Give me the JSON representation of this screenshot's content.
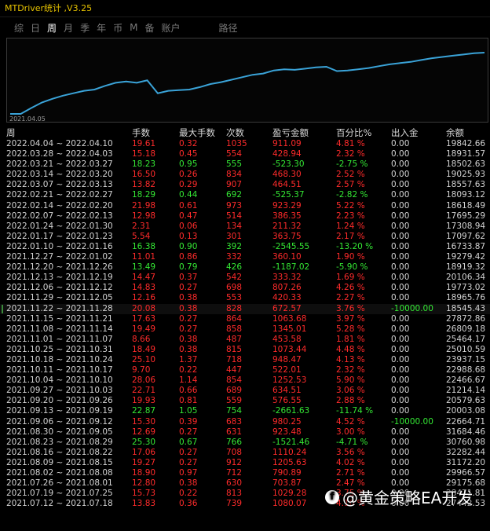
{
  "window": {
    "title": "MTDriver统计 ,V3.25"
  },
  "tabs": [
    {
      "label": "综",
      "active": false
    },
    {
      "label": "日",
      "active": false
    },
    {
      "label": "周",
      "active": true
    },
    {
      "label": "月",
      "active": false
    },
    {
      "label": "季",
      "active": false
    },
    {
      "label": "年",
      "active": false
    },
    {
      "label": "币",
      "active": false
    },
    {
      "label": "M",
      "active": false
    },
    {
      "label": "备",
      "active": false
    },
    {
      "label": "账户",
      "active": false
    }
  ],
  "path_tab": "路径",
  "chart_data": {
    "type": "line",
    "series": [
      {
        "values": [
          19842.66,
          19842.66,
          20800,
          21700,
          22300,
          22800,
          23200,
          23600,
          23800,
          24400,
          24900,
          25100,
          24900,
          25300,
          23200,
          23600,
          23700,
          23800,
          24200,
          24700,
          25000,
          25400,
          25800,
          26200,
          26400,
          26900,
          27100,
          27000,
          27200,
          27400,
          27500,
          26800,
          26900,
          27100,
          27300,
          27600,
          27900,
          28100,
          28300,
          28600,
          28900,
          29100,
          29300,
          29500,
          29700,
          29800
        ]
      }
    ],
    "color": "#3aa3d8",
    "x_start_label": "2021.04.05"
  },
  "table": {
    "headers": [
      "周",
      "手数",
      "最大手数",
      "次数",
      "盈亏金额",
      "百分比%",
      "出入金",
      "余额"
    ],
    "rows": [
      {
        "week": "2022.04.04 ~ 2022.04.10",
        "lots": "19.61",
        "max": "0.32",
        "count": "1035",
        "pnl": "911.09",
        "pct": "4.81 %",
        "flow": "0.00",
        "balance": "19842.66",
        "tone": "red"
      },
      {
        "week": "2022.03.28 ~ 2022.04.03",
        "lots": "15.18",
        "max": "0.45",
        "count": "554",
        "pnl": "428.94",
        "pct": "2.32 %",
        "flow": "0.00",
        "balance": "18931.57",
        "tone": "red"
      },
      {
        "week": "2022.03.21 ~ 2022.03.27",
        "lots": "18.23",
        "max": "0.95",
        "count": "555",
        "pnl": "-523.30",
        "pct": "-2.75 %",
        "flow": "0.00",
        "balance": "18502.63",
        "tone": "pos"
      },
      {
        "week": "2022.03.14 ~ 2022.03.20",
        "lots": "16.50",
        "max": "0.26",
        "count": "834",
        "pnl": "468.30",
        "pct": "2.52 %",
        "flow": "0.00",
        "balance": "19025.93",
        "tone": "red"
      },
      {
        "week": "2022.03.07 ~ 2022.03.13",
        "lots": "13.82",
        "max": "0.29",
        "count": "907",
        "pnl": "464.51",
        "pct": "2.57 %",
        "flow": "0.00",
        "balance": "18557.63",
        "tone": "red"
      },
      {
        "week": "2022.02.21 ~ 2022.02.27",
        "lots": "18.29",
        "max": "0.44",
        "count": "692",
        "pnl": "-525.37",
        "pct": "-2.82 %",
        "flow": "0.00",
        "balance": "18093.12",
        "tone": "pos"
      },
      {
        "week": "2022.02.14 ~ 2022.02.20",
        "lots": "21.98",
        "max": "0.61",
        "count": "973",
        "pnl": "923.29",
        "pct": "5.22 %",
        "flow": "0.00",
        "balance": "18618.49",
        "tone": "red"
      },
      {
        "week": "2022.02.07 ~ 2022.02.13",
        "lots": "12.98",
        "max": "0.47",
        "count": "514",
        "pnl": "386.35",
        "pct": "2.23 %",
        "flow": "0.00",
        "balance": "17695.29",
        "tone": "red"
      },
      {
        "week": "2022.01.24 ~ 2022.01.30",
        "lots": "2.31",
        "max": "0.06",
        "count": "134",
        "pnl": "211.32",
        "pct": "1.24 %",
        "flow": "0.00",
        "balance": "17308.94",
        "tone": "red"
      },
      {
        "week": "2022.01.17 ~ 2022.01.23",
        "lots": "5.54",
        "max": "0.13",
        "count": "301",
        "pnl": "363.75",
        "pct": "2.17 %",
        "flow": "0.00",
        "balance": "17097.62",
        "tone": "red"
      },
      {
        "week": "2022.01.10 ~ 2022.01.16",
        "lots": "16.38",
        "max": "0.90",
        "count": "392",
        "pnl": "-2545.55",
        "pct": "-13.20 %",
        "flow": "0.00",
        "balance": "16733.87",
        "tone": "pos"
      },
      {
        "week": "2021.12.27 ~ 2022.01.02",
        "lots": "11.01",
        "max": "0.86",
        "count": "332",
        "pnl": "360.10",
        "pct": "1.90 %",
        "flow": "0.00",
        "balance": "19279.42",
        "tone": "red"
      },
      {
        "week": "2021.12.20 ~ 2021.12.26",
        "lots": "13.49",
        "max": "0.79",
        "count": "426",
        "pnl": "-1187.02",
        "pct": "-5.90 %",
        "flow": "0.00",
        "balance": "18919.32",
        "tone": "pos"
      },
      {
        "week": "2021.12.13 ~ 2021.12.19",
        "lots": "14.47",
        "max": "0.37",
        "count": "542",
        "pnl": "333.32",
        "pct": "1.69 %",
        "flow": "0.00",
        "balance": "20106.34",
        "tone": "red"
      },
      {
        "week": "2021.12.06 ~ 2021.12.12",
        "lots": "14.83",
        "max": "0.27",
        "count": "698",
        "pnl": "807.26",
        "pct": "4.26 %",
        "flow": "0.00",
        "balance": "19773.02",
        "tone": "red"
      },
      {
        "week": "2021.11.29 ~ 2021.12.05",
        "lots": "12.16",
        "max": "0.38",
        "count": "553",
        "pnl": "420.33",
        "pct": "2.27 %",
        "flow": "0.00",
        "balance": "18965.76",
        "tone": "red"
      },
      {
        "week": "2021.11.22 ~ 2021.11.28",
        "lots": "20.08",
        "max": "0.38",
        "count": "828",
        "pnl": "672.57",
        "pct": "3.76 %",
        "flow": "-10000.00",
        "balance": "18545.43",
        "tone": "red",
        "sel": true,
        "flow_green": true
      },
      {
        "week": "2021.11.15 ~ 2021.11.21",
        "lots": "17.63",
        "max": "0.27",
        "count": "864",
        "pnl": "1063.68",
        "pct": "3.97 %",
        "flow": "0.00",
        "balance": "27872.86",
        "tone": "red"
      },
      {
        "week": "2021.11.08 ~ 2021.11.14",
        "lots": "19.49",
        "max": "0.27",
        "count": "858",
        "pnl": "1345.01",
        "pct": "5.28 %",
        "flow": "0.00",
        "balance": "26809.18",
        "tone": "red"
      },
      {
        "week": "2021.11.01 ~ 2021.11.07",
        "lots": "8.66",
        "max": "0.38",
        "count": "487",
        "pnl": "453.58",
        "pct": "1.81 %",
        "flow": "0.00",
        "balance": "25464.17",
        "tone": "red"
      },
      {
        "week": "2021.10.25 ~ 2021.10.31",
        "lots": "18.49",
        "max": "0.38",
        "count": "815",
        "pnl": "1073.44",
        "pct": "4.48 %",
        "flow": "0.00",
        "balance": "25010.59",
        "tone": "red"
      },
      {
        "week": "2021.10.18 ~ 2021.10.24",
        "lots": "25.10",
        "max": "1.37",
        "count": "718",
        "pnl": "948.47",
        "pct": "4.13 %",
        "flow": "0.00",
        "balance": "23937.15",
        "tone": "red"
      },
      {
        "week": "2021.10.11 ~ 2021.10.17",
        "lots": "9.70",
        "max": "0.22",
        "count": "447",
        "pnl": "522.01",
        "pct": "2.32 %",
        "flow": "0.00",
        "balance": "22988.68",
        "tone": "red"
      },
      {
        "week": "2021.10.04 ~ 2021.10.10",
        "lots": "28.06",
        "max": "1.14",
        "count": "854",
        "pnl": "1252.53",
        "pct": "5.90 %",
        "flow": "0.00",
        "balance": "22466.67",
        "tone": "red"
      },
      {
        "week": "2021.09.27 ~ 2021.10.03",
        "lots": "22.71",
        "max": "0.66",
        "count": "689",
        "pnl": "634.51",
        "pct": "3.06 %",
        "flow": "0.00",
        "balance": "21214.14",
        "tone": "red"
      },
      {
        "week": "2021.09.20 ~ 2021.09.26",
        "lots": "19.93",
        "max": "0.81",
        "count": "559",
        "pnl": "576.55",
        "pct": "2.88 %",
        "flow": "0.00",
        "balance": "20579.63",
        "tone": "red"
      },
      {
        "week": "2021.09.13 ~ 2021.09.19",
        "lots": "22.87",
        "max": "1.05",
        "count": "754",
        "pnl": "-2661.63",
        "pct": "-11.74 %",
        "flow": "0.00",
        "balance": "20003.08",
        "tone": "pos"
      },
      {
        "week": "2021.09.06 ~ 2021.09.12",
        "lots": "15.30",
        "max": "0.39",
        "count": "683",
        "pnl": "980.25",
        "pct": "4.52 %",
        "flow": "-10000.00",
        "balance": "22664.71",
        "tone": "red",
        "flow_green": true
      },
      {
        "week": "2021.08.30 ~ 2021.09.05",
        "lots": "12.69",
        "max": "0.27",
        "count": "631",
        "pnl": "923.48",
        "pct": "3.00 %",
        "flow": "0.00",
        "balance": "31684.46",
        "tone": "red"
      },
      {
        "week": "2021.08.23 ~ 2021.08.29",
        "lots": "25.30",
        "max": "0.67",
        "count": "766",
        "pnl": "-1521.46",
        "pct": "-4.71 %",
        "flow": "0.00",
        "balance": "30760.98",
        "tone": "pos"
      },
      {
        "week": "2021.08.16 ~ 2021.08.22",
        "lots": "17.06",
        "max": "0.27",
        "count": "708",
        "pnl": "1110.24",
        "pct": "3.56 %",
        "flow": "0.00",
        "balance": "32282.44",
        "tone": "red"
      },
      {
        "week": "2021.08.09 ~ 2021.08.15",
        "lots": "19.27",
        "max": "0.27",
        "count": "912",
        "pnl": "1205.63",
        "pct": "4.02 %",
        "flow": "0.00",
        "balance": "31172.20",
        "tone": "red"
      },
      {
        "week": "2021.08.02 ~ 2021.08.08",
        "lots": "18.90",
        "max": "0.97",
        "count": "712",
        "pnl": "790.89",
        "pct": "2.71 %",
        "flow": "0.00",
        "balance": "29966.57",
        "tone": "red"
      },
      {
        "week": "2021.07.26 ~ 2021.08.01",
        "lots": "12.80",
        "max": "0.38",
        "count": "630",
        "pnl": "703.87",
        "pct": "2.47 %",
        "flow": "0.00",
        "balance": "29175.68",
        "tone": "red"
      },
      {
        "week": "2021.07.19 ~ 2021.07.25",
        "lots": "15.73",
        "max": "0.22",
        "count": "813",
        "pnl": "1029.28",
        "pct": "3.75 %",
        "flow": "0.00",
        "balance": "28471.81",
        "tone": "red"
      },
      {
        "week": "2021.07.12 ~ 2021.07.18",
        "lots": "13.83",
        "max": "0.36",
        "count": "739",
        "pnl": "1080.07",
        "pct": "4.10 %",
        "flow": "0.00",
        "balance": "27442.53",
        "tone": "red"
      }
    ]
  },
  "watermark": {
    "icon": "f",
    "text": "@黄金策略EA开发"
  }
}
